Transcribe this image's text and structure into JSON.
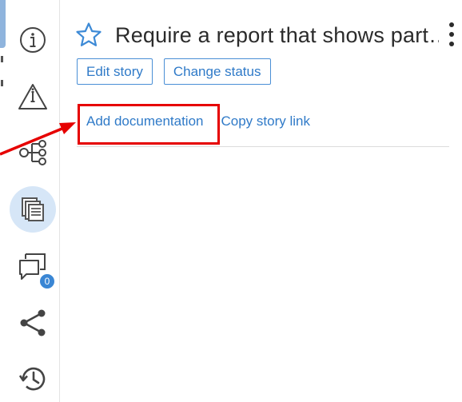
{
  "story": {
    "title": "Require a report that shows part…"
  },
  "actions": {
    "edit_story": "Edit story",
    "change_status": "Change status"
  },
  "links": {
    "add_documentation": "Add documentation",
    "copy_story_link": "Copy story link"
  },
  "sidebar": {
    "items": [
      {
        "icon": "info-icon"
      },
      {
        "icon": "warning-icon"
      },
      {
        "icon": "hierarchy-icon"
      },
      {
        "icon": "documents-icon",
        "active": true
      },
      {
        "icon": "comments-icon",
        "badge": "0"
      },
      {
        "icon": "share-icon"
      },
      {
        "icon": "history-icon"
      }
    ]
  },
  "colors": {
    "accent": "#2f7ac8",
    "active_bg": "#d6e6f7",
    "badge": "#3a86d4",
    "annotation": "#e60000"
  }
}
